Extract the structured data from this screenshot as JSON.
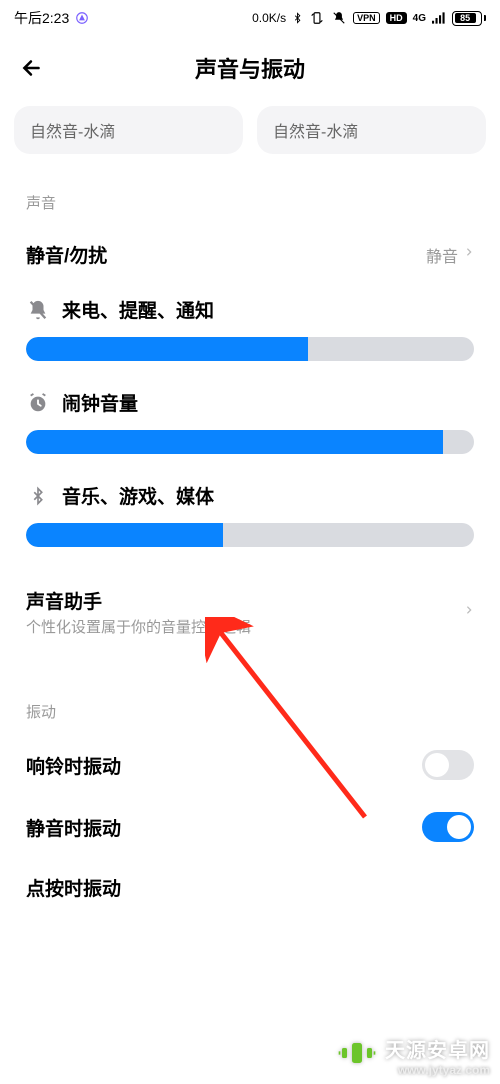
{
  "status": {
    "time": "午后2:23",
    "speed": "0.0K/s",
    "vpn_badge": "VPN",
    "hd_badge": "HD",
    "signal": "4G",
    "battery_pct": 85,
    "battery_label": "85"
  },
  "header": {
    "title": "声音与振动"
  },
  "ringtone_pills": {
    "left": "自然音-水滴",
    "right": "自然音-水滴"
  },
  "sections": {
    "sound_header": "声音",
    "vibration_header": "振动"
  },
  "silent_dnd": {
    "title": "静音/勿扰",
    "value": "静音"
  },
  "sliders": {
    "notify": {
      "label": "来电、提醒、通知",
      "percent": 63
    },
    "alarm": {
      "label": "闹钟音量",
      "percent": 93
    },
    "media": {
      "label": "音乐、游戏、媒体",
      "percent": 44
    }
  },
  "sound_assistant": {
    "title": "声音助手",
    "subtitle": "个性化设置属于你的音量控制逻辑"
  },
  "vibration_rows": {
    "ring": {
      "title": "响铃时振动",
      "on": false
    },
    "silent": {
      "title": "静音时振动",
      "on": true
    },
    "tap": {
      "title": "点按时振动"
    }
  },
  "watermark": {
    "line1": "天源安卓网",
    "line2": "www.jytyaz.com"
  },
  "accent_color": "#0a84ff"
}
